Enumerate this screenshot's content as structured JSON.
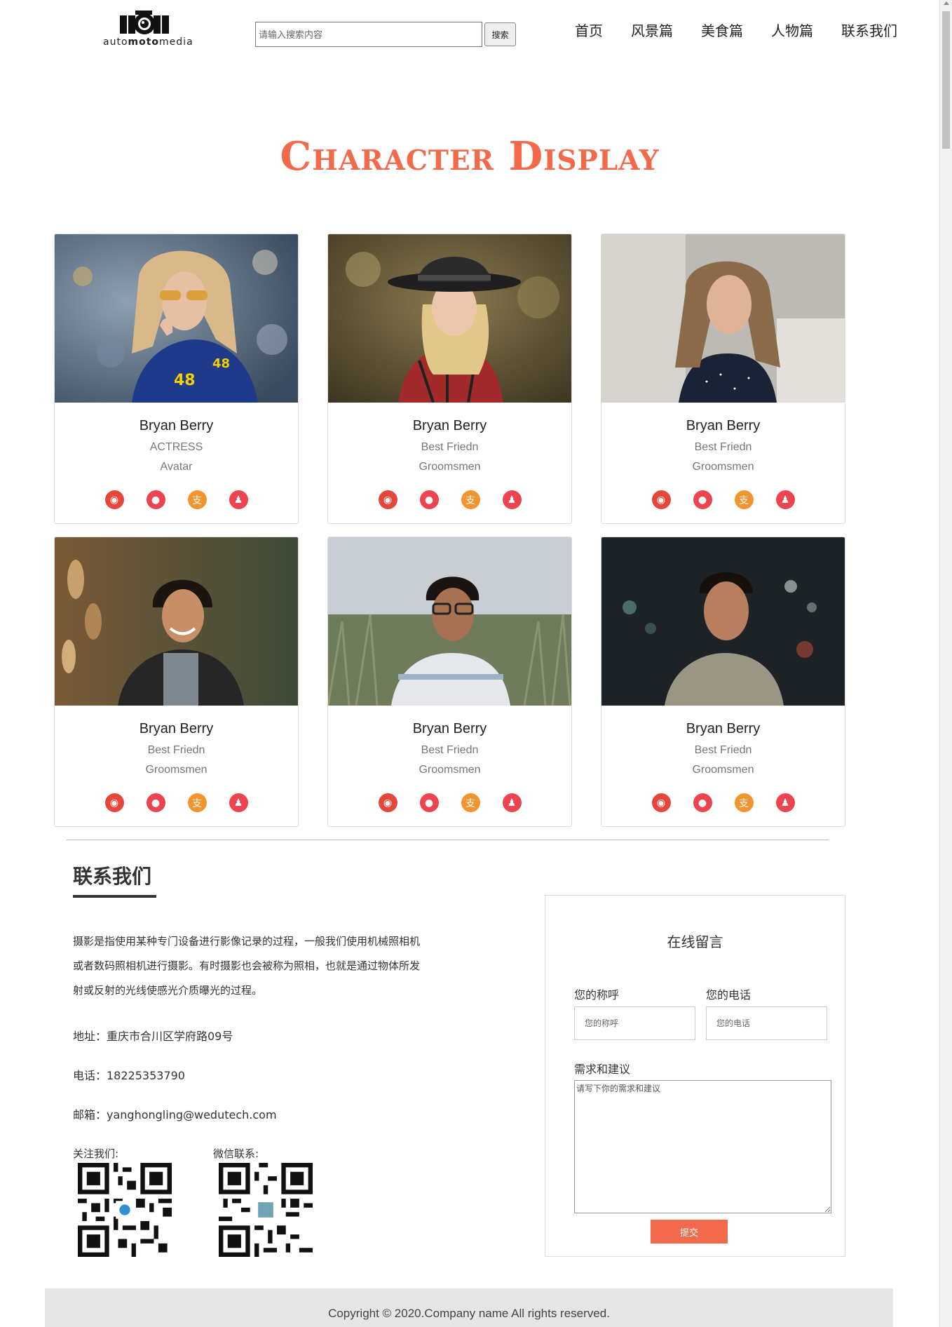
{
  "header": {
    "logo_text_pre": "auto",
    "logo_text_bold": "moto",
    "logo_text_post": "media",
    "search_placeholder": "请输入搜索内容",
    "search_button": "搜索",
    "nav": [
      "首页",
      "风景篇",
      "美食篇",
      "人物篇",
      "联系我们"
    ]
  },
  "page_title": "Character Display",
  "cards": [
    {
      "name": "Bryan Berry",
      "role": "ACTRESS",
      "tag": "Avatar"
    },
    {
      "name": "Bryan Berry",
      "role": "Best Friedn",
      "tag": "Groomsmen"
    },
    {
      "name": "Bryan Berry",
      "role": "Best Friedn",
      "tag": "Groomsmen"
    },
    {
      "name": "Bryan Berry",
      "role": "Best Friedn",
      "tag": "Groomsmen"
    },
    {
      "name": "Bryan Berry",
      "role": "Best Friedn",
      "tag": "Groomsmen"
    },
    {
      "name": "Bryan Berry",
      "role": "Best Friedn",
      "tag": "Groomsmen"
    }
  ],
  "social_icons": [
    "weibo-icon",
    "wechat-icon",
    "alipay-icon",
    "qq-icon"
  ],
  "contact": {
    "title": "联系我们",
    "desc": "摄影是指使用某种专门设备进行影像记录的过程，一般我们使用机械照相机或者数码照相机进行摄影。有时摄影也会被称为照相，也就是通过物体所发射或反射的光线使感光介质曝光的过程。",
    "address": "地址：重庆市合川区学府路09号",
    "phone": "电话：18225353790",
    "email": "邮箱：yanghongling@wedutech.com",
    "follow_label": "关注我们:",
    "wechat_label": "微信联系:"
  },
  "form": {
    "title": "在线留言",
    "name_label": "您的称呼",
    "name_placeholder": "您的称呼",
    "phone_label": "您的电话",
    "phone_placeholder": "您的电话",
    "message_label": "需求和建议",
    "message_placeholder": "请写下你的需求和建议",
    "submit": "提交"
  },
  "footer": {
    "copyright": "Copyright © 2020.Company name All rights reserved."
  },
  "colors": {
    "accent": "#f26a4b",
    "weibo": "#e6473d",
    "wechat": "#ee4450",
    "alipay": "#f2952e",
    "qq": "#ee4450"
  }
}
